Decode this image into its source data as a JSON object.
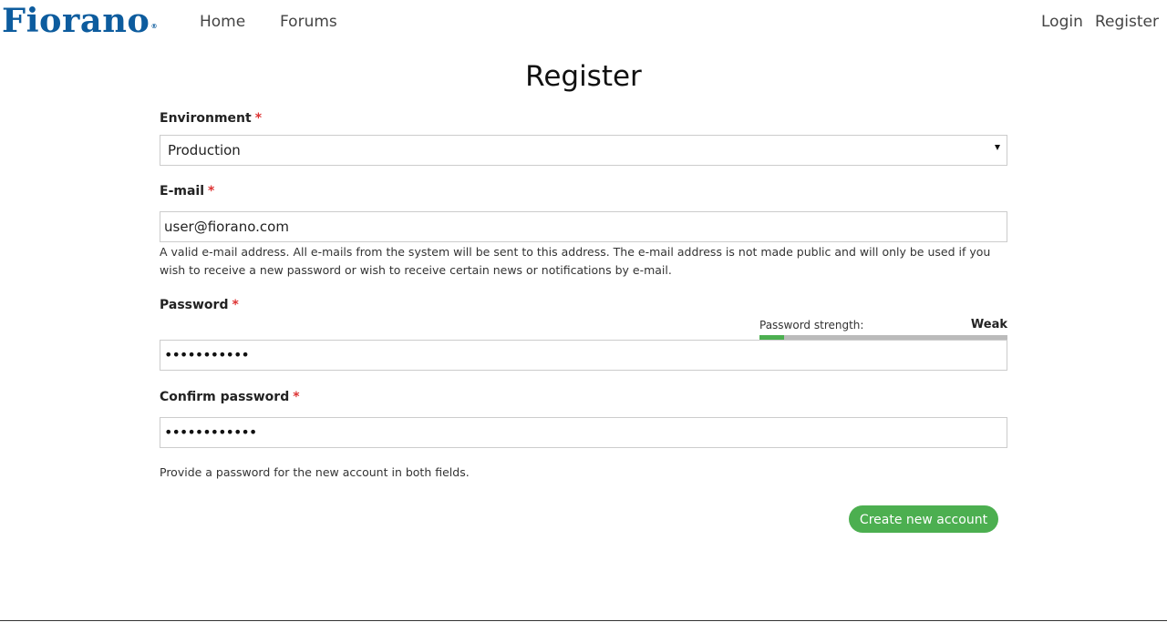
{
  "header": {
    "logo_text": "Fiorano",
    "logo_mark": "®",
    "nav": [
      {
        "label": "Home"
      },
      {
        "label": "Forums"
      }
    ],
    "user_nav": [
      {
        "label": "Login"
      },
      {
        "label": "Register"
      }
    ],
    "brand_color": "#0d5c9e"
  },
  "page": {
    "title": "Register"
  },
  "form": {
    "required_marker": "*",
    "environment": {
      "label": "Environment",
      "value": "Production"
    },
    "email": {
      "label": "E-mail",
      "value": "user@fiorano.com",
      "help": "A valid e-mail address. All e-mails from the system will be sent to this address. The e-mail address is not made public and will only be used if you wish to receive a new password or wish to receive certain news or notifications by e-mail."
    },
    "password": {
      "label": "Password",
      "masked_value": "•••••••••••",
      "strength_label": "Password strength:",
      "strength_value": "Weak",
      "strength_level": 0.1,
      "strength_color": "#4caf50"
    },
    "confirm_password": {
      "label": "Confirm password",
      "masked_value": "••••••••••••"
    },
    "password_help": "Provide a password for the new account in both fields.",
    "submit_label": "Create new account",
    "submit_color": "#4caf50"
  }
}
